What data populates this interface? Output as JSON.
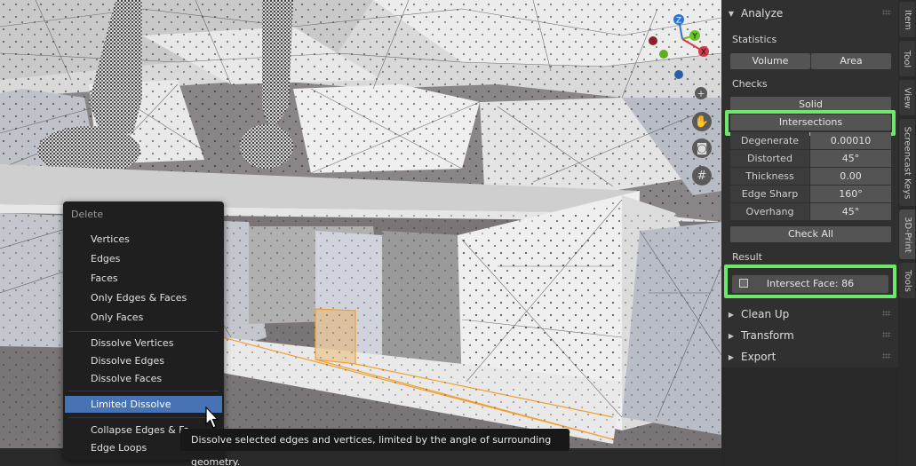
{
  "menu": {
    "title": "Delete",
    "items": [
      "Vertices",
      "Edges",
      "Faces",
      "Only Edges & Faces",
      "Only Faces",
      "Dissolve Vertices",
      "Dissolve Edges",
      "Dissolve Faces",
      "Limited Dissolve",
      "Collapse Edges & Fa",
      "Edge Loops"
    ],
    "active": "Limited Dissolve"
  },
  "tooltip": "Dissolve selected edges and vertices, limited by the angle of surrounding geometry.",
  "gizmo": {
    "z": "Z",
    "y": "Y",
    "x": "X"
  },
  "panel": {
    "analyze_title": "Analyze",
    "statistics_label": "Statistics",
    "volume_btn": "Volume",
    "area_btn": "Area",
    "checks_label": "Checks",
    "solid_btn": "Solid",
    "intersections_btn": "Intersections",
    "checks": [
      {
        "name": "Degenerate",
        "value": "0.00010"
      },
      {
        "name": "Distorted",
        "value": "45°"
      },
      {
        "name": "Thickness",
        "value": "0.00"
      },
      {
        "name": "Edge Sharp",
        "value": "160°"
      },
      {
        "name": "Overhang",
        "value": "45°"
      }
    ],
    "check_all_btn": "Check All",
    "result_label": "Result",
    "result_btn": "Intersect Face: 86",
    "sections": [
      "Clean Up",
      "Transform",
      "Export"
    ]
  },
  "tabs": [
    "Item",
    "Tool",
    "View",
    "Screencast Keys",
    "3D-Print",
    "Tools"
  ],
  "active_tab": "3D-Print",
  "colors": {
    "highlight": "#6ee86b",
    "menu_active": "#4772b3",
    "selection": "#f0a030"
  }
}
